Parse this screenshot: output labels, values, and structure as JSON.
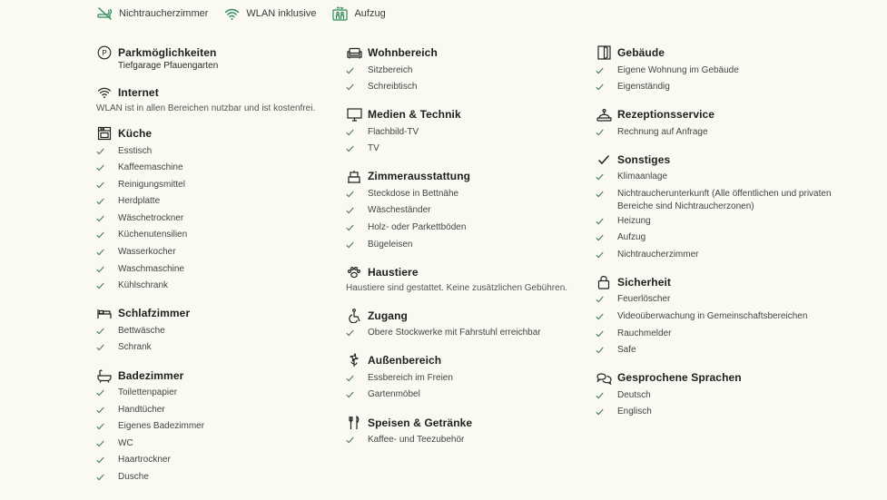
{
  "top_highlights": [
    {
      "icon": "no-smoking-icon",
      "label": "Nichtraucherzimmer"
    },
    {
      "icon": "wifi-icon",
      "label": "WLAN inklusive"
    },
    {
      "icon": "elevator-icon",
      "label": "Aufzug"
    }
  ],
  "colors": {
    "accent": "#2e8b57",
    "text": "#2b2b2b",
    "background": "#faf9f2"
  },
  "col1": {
    "parking": {
      "title": "Parkmöglichkeiten",
      "subtitle": "Tiefgarage Pfauengarten",
      "icon": "parking-icon"
    },
    "internet": {
      "title": "Internet",
      "desc": "WLAN ist in allen Bereichen nutzbar und ist kostenfrei.",
      "icon": "wifi-icon"
    },
    "kitchen": {
      "title": "Küche",
      "icon": "kitchen-icon",
      "items": [
        "Esstisch",
        "Kaffeemaschine",
        "Reinigungsmittel",
        "Herdplatte",
        "Wäschetrockner",
        "Küchenutensilien",
        "Wasserkocher",
        "Waschmaschine",
        "Kühlschrank"
      ]
    },
    "bedroom": {
      "title": "Schlafzimmer",
      "icon": "bed-icon",
      "items": [
        "Bettwäsche",
        "Schrank"
      ]
    },
    "bathroom": {
      "title": "Badezimmer",
      "icon": "bathtub-icon",
      "items": [
        "Toilettenpapier",
        "Handtücher",
        "Eigenes Badezimmer",
        "WC",
        "Haartrockner",
        "Dusche"
      ]
    }
  },
  "col2": {
    "living": {
      "title": "Wohnbereich",
      "icon": "sofa-icon",
      "items": [
        "Sitzbereich",
        "Schreibtisch"
      ]
    },
    "media": {
      "title": "Medien & Technik",
      "icon": "tv-icon",
      "items": [
        "Flachbild-TV",
        "TV"
      ]
    },
    "room": {
      "title": "Zimmerausstattung",
      "icon": "room-equipment-icon",
      "items": [
        "Steckdose in Bettnähe",
        "Wäscheständer",
        "Holz- oder Parkettböden",
        "Bügeleisen"
      ]
    },
    "pets": {
      "title": "Haustiere",
      "icon": "paw-icon",
      "desc": "Haustiere sind gestattet. Keine zusätzlichen Gebühren."
    },
    "access": {
      "title": "Zugang",
      "icon": "accessibility-icon",
      "items": [
        "Obere Stockwerke mit Fahrstuhl erreichbar"
      ]
    },
    "outdoor": {
      "title": "Außenbereich",
      "icon": "flower-icon",
      "items": [
        "Essbereich im Freien",
        "Gartenmöbel"
      ]
    },
    "food": {
      "title": "Speisen & Getränke",
      "icon": "cutlery-icon",
      "items": [
        "Kaffee- und Teezubehör"
      ]
    }
  },
  "col3": {
    "building": {
      "title": "Gebäude",
      "icon": "building-icon",
      "items": [
        "Eigene Wohnung im Gebäude",
        "Eigenständig"
      ]
    },
    "reception": {
      "title": "Rezeptionsservice",
      "icon": "reception-bell-icon",
      "items": [
        "Rechnung auf Anfrage"
      ]
    },
    "misc": {
      "title": "Sonstiges",
      "icon": "check-icon",
      "items": [
        "Klimaanlage",
        "Nichtraucherunterkunft (Alle öffentlichen und privaten Bereiche sind Nichtraucherzonen)",
        "Heizung",
        "Aufzug",
        "Nichtraucherzimmer"
      ]
    },
    "security": {
      "title": "Sicherheit",
      "icon": "lock-icon",
      "items": [
        "Feuerlöscher",
        "Videoüberwachung in Gemeinschaftsbereichen",
        "Rauchmelder",
        "Safe"
      ]
    },
    "languages": {
      "title": "Gesprochene Sprachen",
      "icon": "speech-bubbles-icon",
      "items": [
        "Deutsch",
        "Englisch"
      ]
    }
  }
}
